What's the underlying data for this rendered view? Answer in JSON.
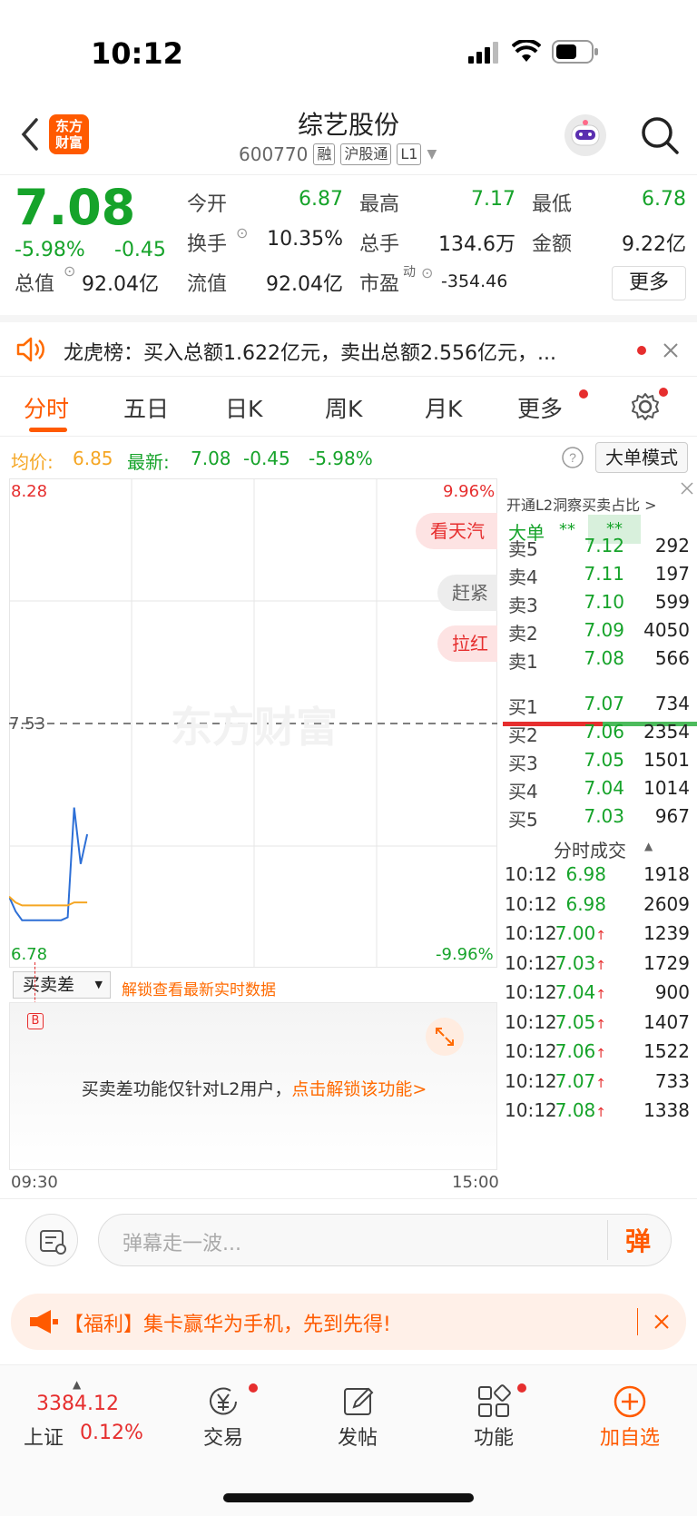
{
  "status": {
    "time": "10:12"
  },
  "header": {
    "logo_text": "东方财富",
    "stock_name": "综艺股份",
    "stock_code": "600770",
    "tags": [
      "融",
      "沪股通",
      "L1"
    ]
  },
  "quote": {
    "price": "7.08",
    "change_pct": "-5.98%",
    "change_val": "-0.45",
    "open_label": "今开",
    "open": "6.87",
    "high_label": "最高",
    "high": "7.17",
    "low_label": "最低",
    "low": "6.78",
    "turnover_label": "换手",
    "turnover": "10.35%",
    "volume_label": "总手",
    "volume": "134.6万",
    "amount_label": "金额",
    "amount": "9.22亿",
    "mktcap_label": "总值",
    "mktcap": "92.04亿",
    "float_label": "流值",
    "float": "92.04亿",
    "pe_label": "市盈",
    "pe_sup": "动",
    "pe": "-354.46",
    "more_label": "更多"
  },
  "notice": {
    "text": "龙虎榜：买入总额1.622亿元，卖出总额2.556亿元，..."
  },
  "tabs": [
    "分时",
    "五日",
    "日K",
    "周K",
    "月K",
    "更多"
  ],
  "inforow": {
    "avg_label": "均价:",
    "avg": "6.85",
    "latest_label": "最新:",
    "latest": "7.08",
    "latest_chg": "-0.45",
    "latest_pct": "-5.98%",
    "bigorder_btn": "大单模式"
  },
  "chart": {
    "y_top": "8.28",
    "y_mid": "7.53",
    "y_bottom": "6.78",
    "pct_top": "9.96%",
    "pct_bottom": "-9.96%",
    "watermark": "东方财富",
    "danmaku": [
      "看天汽",
      "赶紧",
      "拉红"
    ],
    "x_start": "09:30",
    "x_end": "15:00"
  },
  "chart_data": {
    "type": "line",
    "ylim": [
      6.78,
      8.28
    ],
    "x": [
      "09:30",
      "09:31",
      "09:32",
      "09:33",
      "09:34",
      "09:35",
      "09:36",
      "09:37",
      "09:38",
      "09:39",
      "09:40",
      "09:41",
      "09:42"
    ],
    "series": [
      {
        "name": "",
        "values": [
          6.87,
          6.82,
          6.79,
          6.79,
          6.79,
          6.79,
          6.79,
          6.79,
          6.79,
          6.8,
          7.17,
          6.98,
          7.08
        ]
      },
      {
        "name": "均价",
        "values": [
          6.87,
          6.85,
          6.84,
          6.84,
          6.84,
          6.84,
          6.84,
          6.84,
          6.84,
          6.84,
          6.85,
          6.85,
          6.85
        ]
      }
    ]
  },
  "book": {
    "l2_link": "开通L2洞察买卖占比 >",
    "bigorder_label": "大单",
    "bigorder_val1": "**",
    "bigorder_val2": "**",
    "asks": [
      {
        "label": "卖5",
        "price": "7.12",
        "vol": "292"
      },
      {
        "label": "卖4",
        "price": "7.11",
        "vol": "197"
      },
      {
        "label": "卖3",
        "price": "7.10",
        "vol": "599"
      },
      {
        "label": "卖2",
        "price": "7.09",
        "vol": "4050"
      },
      {
        "label": "卖1",
        "price": "7.08",
        "vol": "566"
      }
    ],
    "bids": [
      {
        "label": "买1",
        "price": "7.07",
        "vol": "734"
      },
      {
        "label": "买2",
        "price": "7.06",
        "vol": "2354"
      },
      {
        "label": "买3",
        "price": "7.05",
        "vol": "1501"
      },
      {
        "label": "买4",
        "price": "7.04",
        "vol": "1014"
      },
      {
        "label": "买5",
        "price": "7.03",
        "vol": "967"
      }
    ],
    "ticks_title": "分时成交",
    "ticks": [
      {
        "time": "10:12",
        "price": "6.98",
        "arrow": "",
        "vol": "1918",
        "pcolor": "green"
      },
      {
        "time": "10:12",
        "price": "6.98",
        "arrow": "",
        "vol": "2609",
        "pcolor": "green"
      },
      {
        "time": "10:12",
        "price": "7.00",
        "arrow": "↑",
        "vol": "1239",
        "pcolor": "green"
      },
      {
        "time": "10:12",
        "price": "7.03",
        "arrow": "↑",
        "vol": "1729",
        "pcolor": "green"
      },
      {
        "time": "10:12",
        "price": "7.04",
        "arrow": "↑",
        "vol": "900",
        "pcolor": "green"
      },
      {
        "time": "10:12",
        "price": "7.05",
        "arrow": "↑",
        "vol": "1407",
        "pcolor": "green"
      },
      {
        "time": "10:12",
        "price": "7.06",
        "arrow": "↑",
        "vol": "1522",
        "pcolor": "green"
      },
      {
        "time": "10:12",
        "price": "7.07",
        "arrow": "↑",
        "vol": "733",
        "pcolor": "green"
      },
      {
        "time": "10:12",
        "price": "7.08",
        "arrow": "↑",
        "vol": "1338",
        "pcolor": "green"
      }
    ]
  },
  "spread": {
    "select_label": "买卖差",
    "unlock_text": "解锁查看最新实时数据",
    "b_marker": "B",
    "panel_text": "买卖差功能仅针对L2用户，",
    "panel_link": "点击解锁该功能>"
  },
  "comment": {
    "placeholder": "弹幕走一波...",
    "dan_btn": "弹"
  },
  "promo": {
    "text": "【福利】集卡赢华为手机，先到先得!"
  },
  "bottomnav": {
    "index_value": "3384.12",
    "index_name": "上证",
    "index_pct": "0.12%",
    "items": [
      "交易",
      "发帖",
      "功能",
      "加自选"
    ]
  },
  "colors": {
    "accent": "#ff5a00",
    "up": "#e62e2e",
    "down": "#16a32a",
    "avg_line": "#f5a623",
    "price_line": "#2d6fd6"
  }
}
